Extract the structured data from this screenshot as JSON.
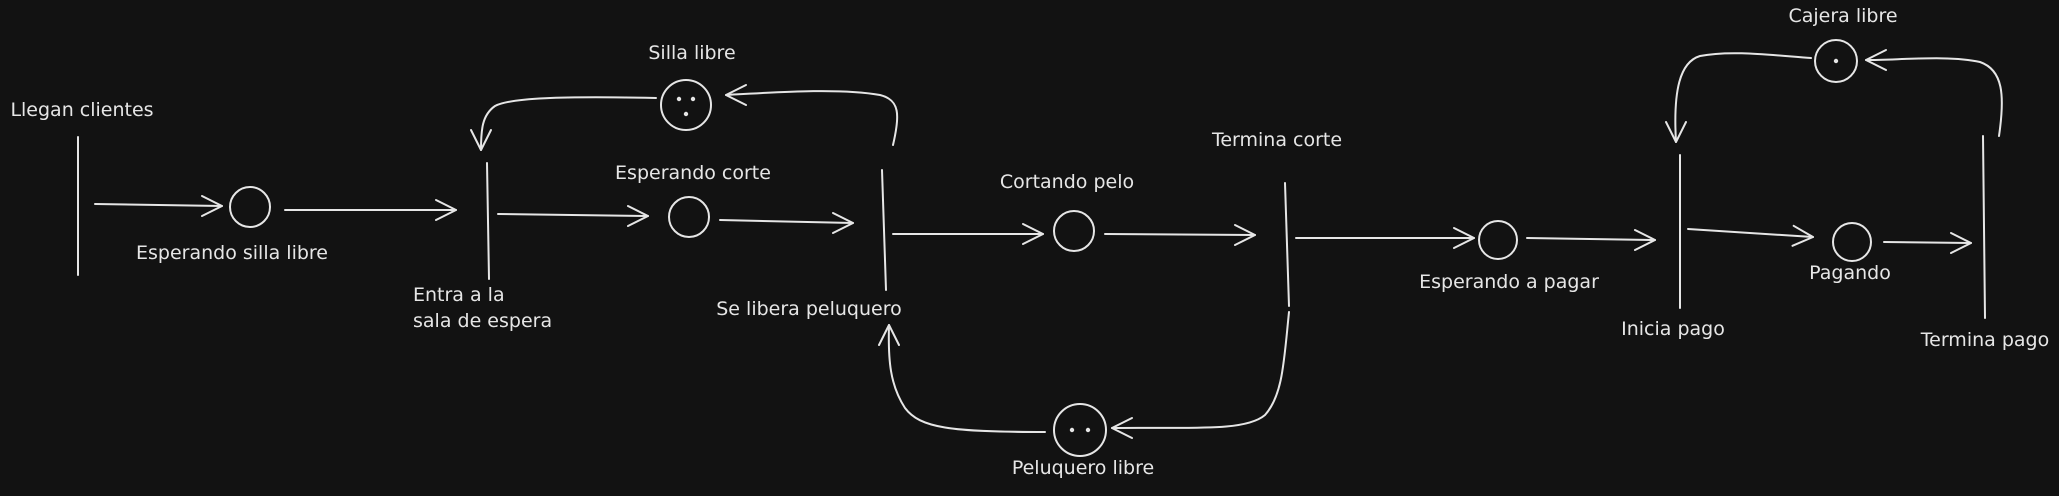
{
  "places": [
    {
      "id": "p1",
      "label": "Esperando silla libre",
      "tokens": 0
    },
    {
      "id": "p2",
      "label": "Silla libre",
      "tokens": 3
    },
    {
      "id": "p3",
      "label": "Esperando corte",
      "tokens": 0
    },
    {
      "id": "p4",
      "label": "Cortando pelo",
      "tokens": 0
    },
    {
      "id": "p5",
      "label": "Peluquero libre",
      "tokens": 2
    },
    {
      "id": "p6",
      "label": "Esperando a pagar",
      "tokens": 0
    },
    {
      "id": "p7",
      "label": "Cajera libre",
      "tokens": 1
    },
    {
      "id": "p8",
      "label": "Pagando",
      "tokens": 0
    }
  ],
  "transitions": [
    {
      "id": "t1",
      "label_lines": [
        "Llegan clientes"
      ]
    },
    {
      "id": "t2",
      "label_lines": [
        "Entra a la",
        "sala de espera"
      ]
    },
    {
      "id": "t3",
      "label_lines": [
        "Se libera peluquero"
      ]
    },
    {
      "id": "t4",
      "label_lines": [
        "Termina corte"
      ]
    },
    {
      "id": "t5",
      "label_lines": [
        "Inicia pago"
      ]
    },
    {
      "id": "t6",
      "label_lines": [
        "Termina pago"
      ]
    }
  ],
  "arcs": [
    {
      "from": "t1",
      "to": "p1"
    },
    {
      "from": "p1",
      "to": "t2"
    },
    {
      "from": "p2",
      "to": "t2"
    },
    {
      "from": "t2",
      "to": "p3"
    },
    {
      "from": "p3",
      "to": "t3"
    },
    {
      "from": "t3",
      "to": "p2"
    },
    {
      "from": "t3",
      "to": "p4"
    },
    {
      "from": "p5",
      "to": "t3"
    },
    {
      "from": "p4",
      "to": "t4"
    },
    {
      "from": "t4",
      "to": "p5"
    },
    {
      "from": "t4",
      "to": "p6"
    },
    {
      "from": "p6",
      "to": "t5"
    },
    {
      "from": "p7",
      "to": "t5"
    },
    {
      "from": "t5",
      "to": "p8"
    },
    {
      "from": "p8",
      "to": "t6"
    },
    {
      "from": "t6",
      "to": "p7"
    }
  ]
}
